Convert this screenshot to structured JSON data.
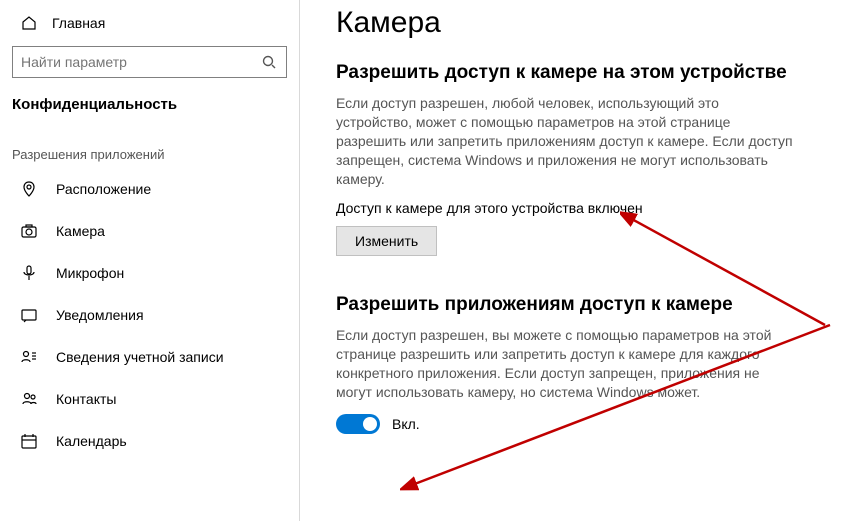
{
  "sidebar": {
    "home": "Главная",
    "search_placeholder": "Найти параметр",
    "category": "Конфиденциальность",
    "section_label": "Разрешения приложений",
    "items": [
      {
        "label": "Расположение"
      },
      {
        "label": "Камера"
      },
      {
        "label": "Микрофон"
      },
      {
        "label": "Уведомления"
      },
      {
        "label": "Сведения учетной записи"
      },
      {
        "label": "Контакты"
      },
      {
        "label": "Календарь"
      }
    ]
  },
  "page": {
    "title": "Камера",
    "section1": {
      "title": "Разрешить доступ к камере на этом устройстве",
      "desc": "Если доступ разрешен, любой человек, использующий это устройство, может с помощью параметров на этой странице разрешить или запретить приложениям доступ к камере. Если доступ запрещен, система Windows и приложения не могут использовать камеру.",
      "status": "Доступ к камере для этого устройства включен",
      "button": "Изменить"
    },
    "section2": {
      "title": "Разрешить приложениям доступ к камере",
      "desc": "Если доступ разрешен, вы можете с помощью параметров на этой странице разрешить или запретить доступ к камере для каждого конкретного приложения. Если доступ запрещен, приложения не могут использовать камеру, но система Windows может.",
      "toggle_label": "Вкл."
    }
  },
  "colors": {
    "accent": "#0078d4",
    "arrow": "#c00000"
  }
}
